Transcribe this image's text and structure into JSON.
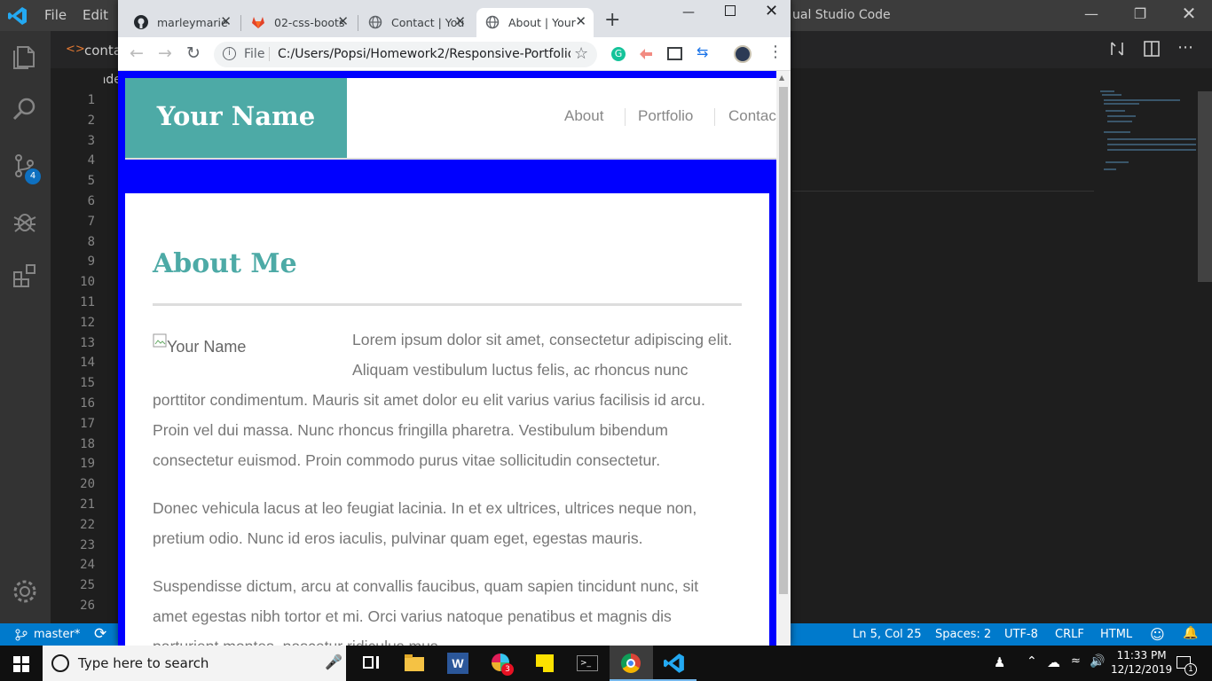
{
  "vscode": {
    "menu": [
      "File",
      "Edit"
    ],
    "title_fragment": "ual Studio Code",
    "tab_label": "conta",
    "breadcrumb": "inde",
    "scm_badge": "4",
    "line_numbers": [
      "1",
      "2",
      "3",
      "4",
      "5",
      "6",
      "7",
      "8",
      "9",
      "10",
      "11",
      "12",
      "13",
      "14",
      "15",
      "16",
      "17",
      "18",
      "19",
      "20",
      "21",
      "22",
      "23",
      "24",
      "25",
      "26"
    ],
    "status": {
      "branch": "master*",
      "position": "Ln 5, Col 25",
      "spaces": "Spaces: 2",
      "encoding": "UTF-8",
      "eol": "CRLF",
      "language": "HTML",
      "notifications": "1"
    },
    "accent": "#007acc"
  },
  "chrome": {
    "tabs": [
      {
        "title": "marleymarie",
        "icon": "github-icon"
      },
      {
        "title": "02-css-boots",
        "icon": "gitlab-icon"
      },
      {
        "title": "Contact | You",
        "icon": "globe-icon"
      },
      {
        "title": "About | Your",
        "icon": "globe-icon",
        "active": true
      }
    ],
    "url_scheme": "File",
    "url": "C:/Users/Popsi/Homework2/Responsive-Portfolio/i..."
  },
  "page": {
    "logo": "Your Name",
    "nav": [
      "About",
      "Portfolio",
      "Contac"
    ],
    "heading": "About Me",
    "image_alt": "Your Name",
    "paragraphs": [
      {
        "lines": [
          "Lorem ipsum dolor sit amet, consectetur adipiscing elit.",
          "Aliquam vestibulum luctus felis, ac rhoncus nunc",
          "porttitor condimentum. Mauris sit amet dolor eu elit varius varius facilisis id arcu.",
          "Proin vel dui massa. Nunc rhoncus fringilla pharetra. Vestibulum bibendum",
          "consectetur euismod. Proin commodo purus vitae sollicitudin consectetur."
        ]
      },
      {
        "lines": [
          "Donec vehicula lacus at leo feugiat lacinia. In et ex ultrices, ultrices neque non,",
          "pretium odio. Nunc id eros iaculis, pulvinar quam eget, egestas mauris."
        ]
      },
      {
        "lines": [
          "Suspendisse dictum, arcu at convallis faucibus, quam sapien tincidunt nunc, sit",
          "amet egestas nibh tortor et mi. Orci varius natoque penatibus et magnis dis",
          "parturient montes, nascetur ridiculus mus."
        ]
      }
    ],
    "brand_color": "#4daaa6",
    "background_color": "#0000ff"
  },
  "taskbar": {
    "search_placeholder": "Type here to search",
    "slack_badge": "3",
    "time": "11:33 PM",
    "date": "12/12/2019",
    "notification_count": "1"
  }
}
